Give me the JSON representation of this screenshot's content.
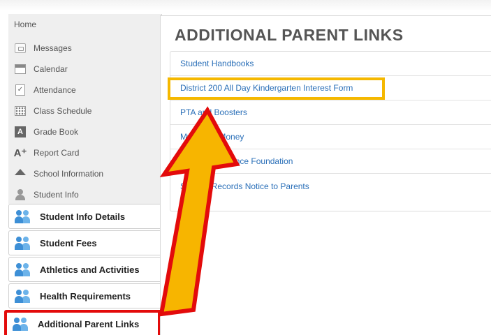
{
  "sidebar": {
    "home_label": "Home",
    "nav_items": [
      {
        "label": "Messages",
        "icon": "envelope-icon"
      },
      {
        "label": "Calendar",
        "icon": "calendar-icon"
      },
      {
        "label": "Attendance",
        "icon": "attendance-icon"
      },
      {
        "label": "Class Schedule",
        "icon": "schedule-icon"
      },
      {
        "label": "Grade Book",
        "icon": "gradebook-icon"
      },
      {
        "label": "Report Card",
        "icon": "report-card-icon"
      },
      {
        "label": "School Information",
        "icon": "school-icon"
      },
      {
        "label": "Student Info",
        "icon": "person-icon"
      }
    ],
    "tabs": [
      {
        "label": "Student Info Details",
        "icon": "people-icon"
      },
      {
        "label": "Student Fees",
        "icon": "people-icon"
      },
      {
        "label": "Athletics and Activities",
        "icon": "people-icon"
      },
      {
        "label": "Health Requirements",
        "icon": "people-icon"
      },
      {
        "label": "Additional Parent Links",
        "icon": "people-icon",
        "active": true
      }
    ]
  },
  "main": {
    "title": "ADDITIONAL PARENT LINKS",
    "links": [
      "Student Handbooks",
      "District 200 All Day Kindergarten Interest Form",
      "PTA and Boosters",
      "My Lunch Money",
      "School Excellence Foundation",
      "Student Records Notice to Parents"
    ]
  },
  "colors": {
    "link": "#2a6fb8",
    "active_tab_border": "#e30b0b",
    "highlight_border": "#f5b800",
    "arrow_fill": "#f7b500",
    "arrow_outline": "#e30b0b"
  }
}
